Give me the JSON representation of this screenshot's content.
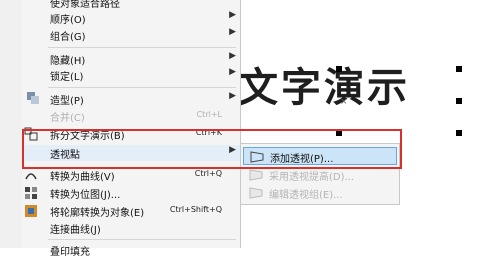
{
  "canvas_text": "文字演示",
  "menu": {
    "items": [
      {
        "label": "使对象适合路径",
        "shortcut": "",
        "submenu": false,
        "disabled": false
      },
      {
        "label": "顺序(O)",
        "shortcut": "",
        "submenu": true,
        "disabled": false
      },
      {
        "label": "组合(G)",
        "shortcut": "",
        "submenu": true,
        "disabled": false
      },
      {
        "label": "隐藏(H)",
        "shortcut": "",
        "submenu": true,
        "disabled": false
      },
      {
        "label": "锁定(L)",
        "shortcut": "",
        "submenu": true,
        "disabled": false
      },
      {
        "label": "造型(P)",
        "shortcut": "",
        "submenu": true,
        "disabled": false
      },
      {
        "label": "合并(C)",
        "shortcut": "Ctrl+L",
        "submenu": false,
        "disabled": true
      },
      {
        "label": "拆分文字演示(B)",
        "shortcut": "Ctrl+K",
        "submenu": false,
        "disabled": false
      },
      {
        "label": "透视點",
        "shortcut": "",
        "submenu": true,
        "disabled": false
      },
      {
        "label": "转换为曲线(V)",
        "shortcut": "Ctrl+Q",
        "submenu": false,
        "disabled": false
      },
      {
        "label": "转换为位图(J)...",
        "shortcut": "",
        "submenu": false,
        "disabled": false
      },
      {
        "label": "将轮廓转换为对象(E)",
        "shortcut": "Ctrl+Shift+Q",
        "submenu": false,
        "disabled": false
      },
      {
        "label": "连接曲线(J)",
        "shortcut": "",
        "submenu": false,
        "disabled": false
      },
      {
        "label": "叠印填充",
        "shortcut": "",
        "submenu": false,
        "disabled": false
      }
    ]
  },
  "submenu": {
    "items": [
      {
        "label": "添加透视(P)...",
        "disabled": false,
        "selected": true
      },
      {
        "label": "采用透视提高(D)...",
        "disabled": true,
        "selected": false
      },
      {
        "label": "编辑透视组(E)...",
        "disabled": true,
        "selected": false
      }
    ]
  },
  "colors": {
    "highlight_border": "#d9302c",
    "selected_bg": "#cce4f7"
  }
}
